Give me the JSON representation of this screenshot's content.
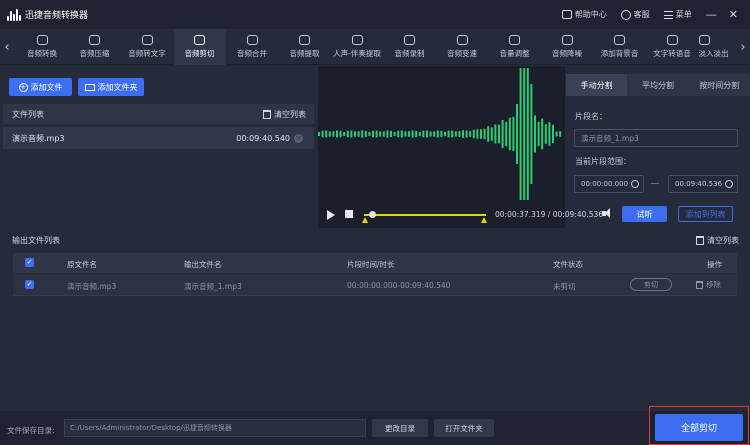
{
  "app": {
    "title": "迅捷音频转换器"
  },
  "titlebar": {
    "help": "帮助中心",
    "service": "客服",
    "menu": "菜单",
    "minimize": "—",
    "close": "✕"
  },
  "toolbar": {
    "prev": "‹",
    "next": "›",
    "tools": [
      {
        "label": "音频转换",
        "icon": "convert-icon"
      },
      {
        "label": "音频压缩",
        "icon": "compress-icon"
      },
      {
        "label": "音频转文字",
        "icon": "speech-to-text-icon"
      },
      {
        "label": "音频剪切",
        "icon": "scissors-icon",
        "active": true
      },
      {
        "label": "音频合并",
        "icon": "merge-icon"
      },
      {
        "label": "音频提取",
        "icon": "extract-icon"
      },
      {
        "label": "人声-伴奏提取",
        "icon": "vocal-extract-icon"
      },
      {
        "label": "音频录制",
        "icon": "record-icon"
      },
      {
        "label": "音频变速",
        "icon": "speed-icon"
      },
      {
        "label": "音量调整",
        "icon": "volume-icon"
      },
      {
        "label": "音频降噪",
        "icon": "denoise-icon"
      },
      {
        "label": "添加背景音",
        "icon": "background-music-icon"
      },
      {
        "label": "文字转语音",
        "icon": "text-to-speech-icon"
      },
      {
        "label": "淡入淡出",
        "icon": "fade-icon"
      }
    ]
  },
  "left": {
    "add_file": "添加文件",
    "add_folder": "添加文件夹",
    "file_list_title": "文件列表",
    "clear_list": "清空列表",
    "files": [
      {
        "name": "演示音频.mp3",
        "duration": "00:09:40.540"
      }
    ]
  },
  "player": {
    "current": "00:00:37.319",
    "separator": "/",
    "total": "00:09:40.536",
    "audition": "试听",
    "add_to_list": "添加到列表",
    "position_fraction": 0.064
  },
  "split": {
    "tabs": [
      "手动分割",
      "平均分割",
      "按时间分割"
    ],
    "segment_label": "片段名：",
    "segment_value": "演示音频_1.mp3",
    "range_label": "当前片段范围：",
    "start": "00:00:00.000",
    "end": "00:09:40.536"
  },
  "output": {
    "title": "输出文件列表",
    "clear": "清空列表",
    "headers": {
      "original": "原文件名",
      "output": "输出文件名",
      "time": "片段时间/时长",
      "status": "文件状态",
      "action": "操作"
    },
    "rows": [
      {
        "original": "演示音频.mp3",
        "output": "演示音频_1.mp3",
        "time": "00:00:00.000-00:09:40.540",
        "status": "未剪切",
        "cut": "剪切",
        "remove": "移除"
      }
    ]
  },
  "bottom": {
    "save_label": "文件保存目录:",
    "save_path": "C:/Users/Administrator/Desktop/迅捷音频转换器",
    "change_dir": "更改目录",
    "open_folder": "打开文件夹",
    "cut_all": "全部剪切"
  },
  "colors": {
    "accent": "#3d6ef2",
    "waveform": "#2ecc71",
    "selection": "#e6d600",
    "highlight_border": "#e03a3a"
  }
}
